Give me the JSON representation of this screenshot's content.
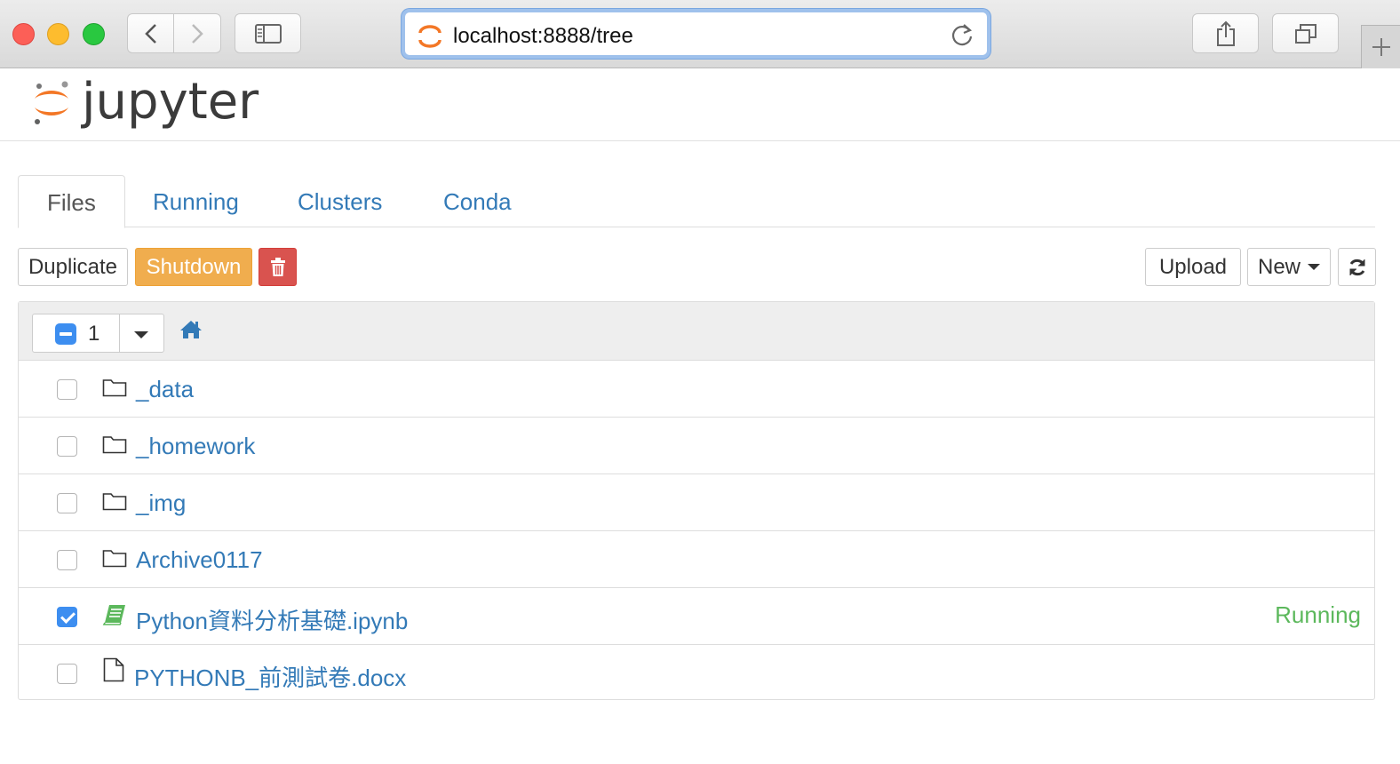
{
  "browser": {
    "url": "localhost:8888/tree"
  },
  "header": {
    "logo_text": "jupyter"
  },
  "tabs": [
    {
      "label": "Files",
      "active": true
    },
    {
      "label": "Running",
      "active": false
    },
    {
      "label": "Clusters",
      "active": false
    },
    {
      "label": "Conda",
      "active": false
    }
  ],
  "toolbar": {
    "duplicate_label": "Duplicate",
    "shutdown_label": "Shutdown",
    "upload_label": "Upload",
    "new_label": "New"
  },
  "list": {
    "selected_count": "1",
    "items": [
      {
        "name": "_data",
        "type": "folder",
        "checked": false,
        "status": ""
      },
      {
        "name": "_homework",
        "type": "folder",
        "checked": false,
        "status": ""
      },
      {
        "name": "_img",
        "type": "folder",
        "checked": false,
        "status": ""
      },
      {
        "name": "Archive0117",
        "type": "folder",
        "checked": false,
        "status": ""
      },
      {
        "name": "Python資料分析基礎.ipynb",
        "type": "notebook",
        "checked": true,
        "status": "Running"
      },
      {
        "name": "PYTHONB_前測試卷.docx",
        "type": "file",
        "checked": false,
        "status": ""
      }
    ]
  },
  "colors": {
    "link": "#337ab7",
    "running": "#5cb85c",
    "shutdown": "#f0ad4e",
    "delete": "#d9534f",
    "checkbox": "#3d8ef0",
    "logo_orange": "#f37726"
  }
}
